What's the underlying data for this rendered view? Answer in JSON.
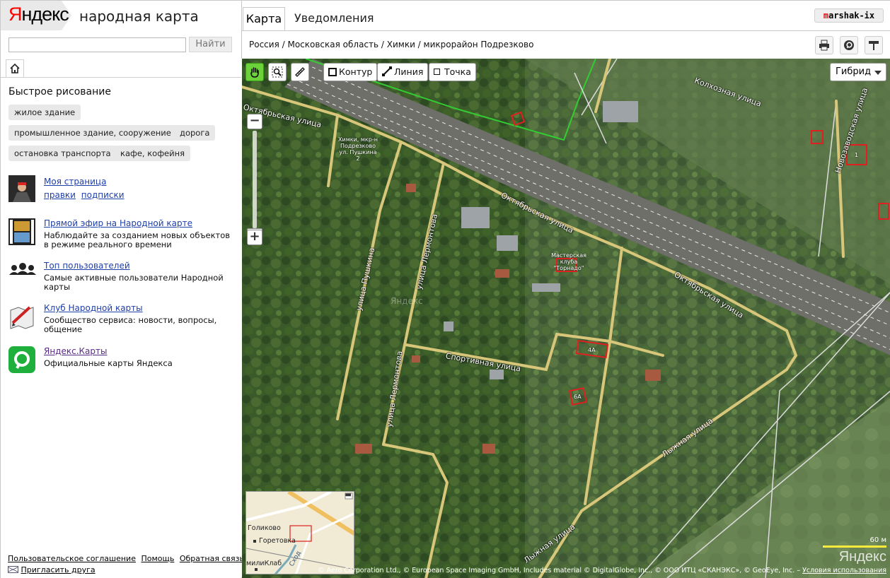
{
  "header": {
    "logo_first": "Я",
    "logo_rest": "ндекс",
    "app_title": "народная карта"
  },
  "search": {
    "value": "",
    "placeholder": "",
    "button": "Найти"
  },
  "quick_draw": {
    "title": "Быстрое рисование",
    "chips": [
      "жилое здание",
      "промышленное здание, сооружение",
      "дорога",
      "остановка транспорта",
      "кафе, кофейня"
    ]
  },
  "profile": {
    "link": "Моя страница",
    "edits": "правки",
    "subscriptions": "подписки"
  },
  "items": [
    {
      "link": "Прямой эфир на Народной карте",
      "desc": "Наблюдайте за созданием новых объектов в режиме реального времени",
      "icon": "film-icon"
    },
    {
      "link": "Топ пользователей",
      "desc": "Самые активные пользователи Народной карты",
      "icon": "users-icon"
    },
    {
      "link": "Клуб Народной карты",
      "desc": "Сообщество сервиса: новости, вопросы, общение",
      "icon": "map-pen-icon"
    },
    {
      "link": "Яндекс.Карты",
      "desc": "Официальные карты Яндекса",
      "icon": "yandex-maps-icon"
    }
  ],
  "footer": {
    "agreement": "Пользовательское соглашение",
    "help": "Помощь",
    "feedback": "Обратная связь",
    "invite": "Пригласить друга"
  },
  "tabs": {
    "map": "Карта",
    "notifications": "Уведомления"
  },
  "user": {
    "first": "m",
    "rest": "arshak-ix"
  },
  "breadcrumb": "Россия / Московская область / Химки / микрорайон Подрезково",
  "map": {
    "tools": {
      "contour": "Контур",
      "line": "Линия",
      "point": "Точка"
    },
    "layer": "Гибрид",
    "streets": {
      "oktyabrskaya": "Октябрьская улица",
      "kolkhoznaya": "Колхозная улица",
      "novozavodskaya": "Новозаводская улица",
      "pushkina": "улица Пушкина",
      "lermontova": "улица Лермонтова",
      "sportivnaya": "Спортивная улица",
      "lyzhnaya": "Лыжная улица"
    },
    "building_labels": {
      "khimki": "Химки, мкр-н Подрезково ул. Пушкина 2",
      "tornado": "Мастерская клуба \"Торнадо\"",
      "b4a": "4А",
      "b6a": "6А",
      "b1": "1"
    },
    "watermark": "Яндекс",
    "minimap": {
      "golikovo": "Голиково",
      "goretovka": "Горетовка",
      "club": "милиКлаб",
      "skhod": "Сход"
    },
    "scale": "60 м",
    "logo": "Яндекс",
    "copyright": "© Aero Corporation Ltd., © European Space Imaging GmbH, Includes material © DigitalGlobe, Inc., © ООО ИТЦ «СКАНЭКС», © GeoEye, Inc. –",
    "terms": "Условия использования"
  }
}
